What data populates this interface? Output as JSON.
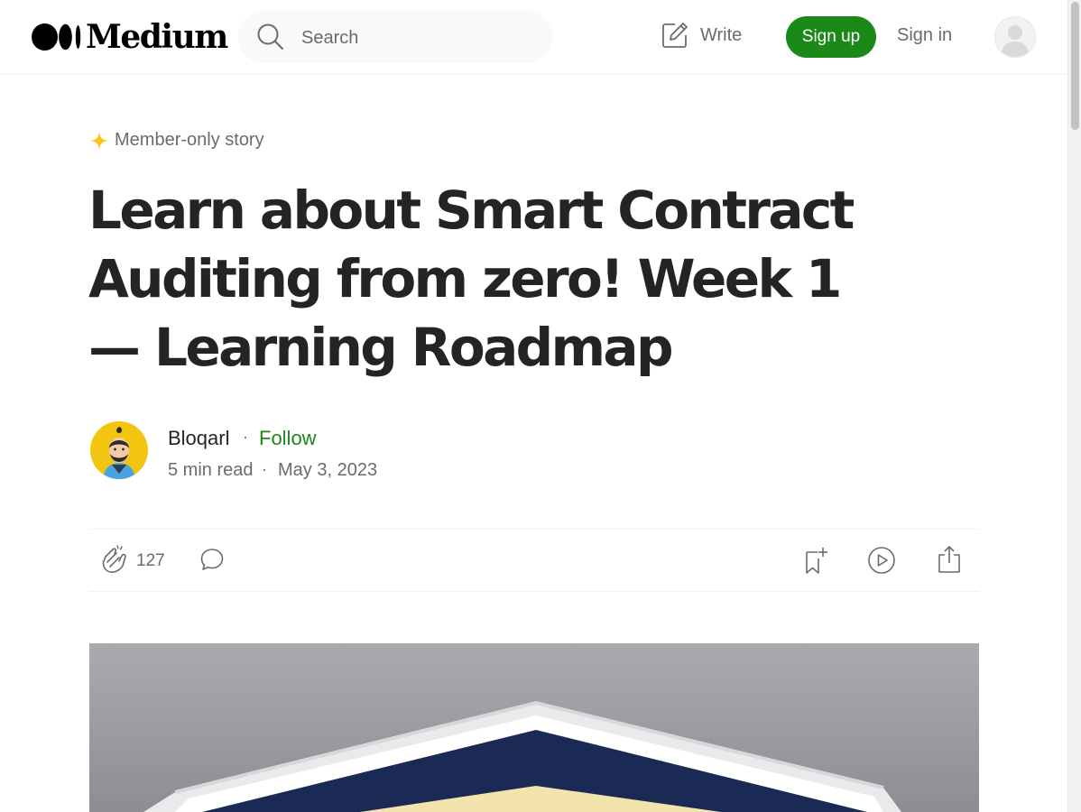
{
  "header": {
    "logo_text": "Medium",
    "search": {
      "placeholder": "Search"
    },
    "write_label": "Write",
    "signup_label": "Sign up",
    "signin_label": "Sign in",
    "icons": {
      "search": "search-icon",
      "write": "pencil-square-icon",
      "user": "user-avatar-icon"
    }
  },
  "article": {
    "member_label": "Member-only story",
    "title": "Learn about Smart Contract Auditing from zero! Week 1 — Learning Roadmap",
    "author": {
      "name": "Bloqarl",
      "separator": "·",
      "follow_label": "Follow",
      "read_time": "5 min read",
      "date": "May 3, 2023"
    },
    "actions": {
      "clap_count": "127",
      "icons": [
        "clap-icon",
        "comment-icon",
        "bookmark-add-icon",
        "play-icon",
        "share-icon"
      ]
    }
  },
  "colors": {
    "accent_green": "#1a8917",
    "member_star": "#ffc017",
    "text_primary": "#242424",
    "text_secondary": "#6b6b6b"
  }
}
